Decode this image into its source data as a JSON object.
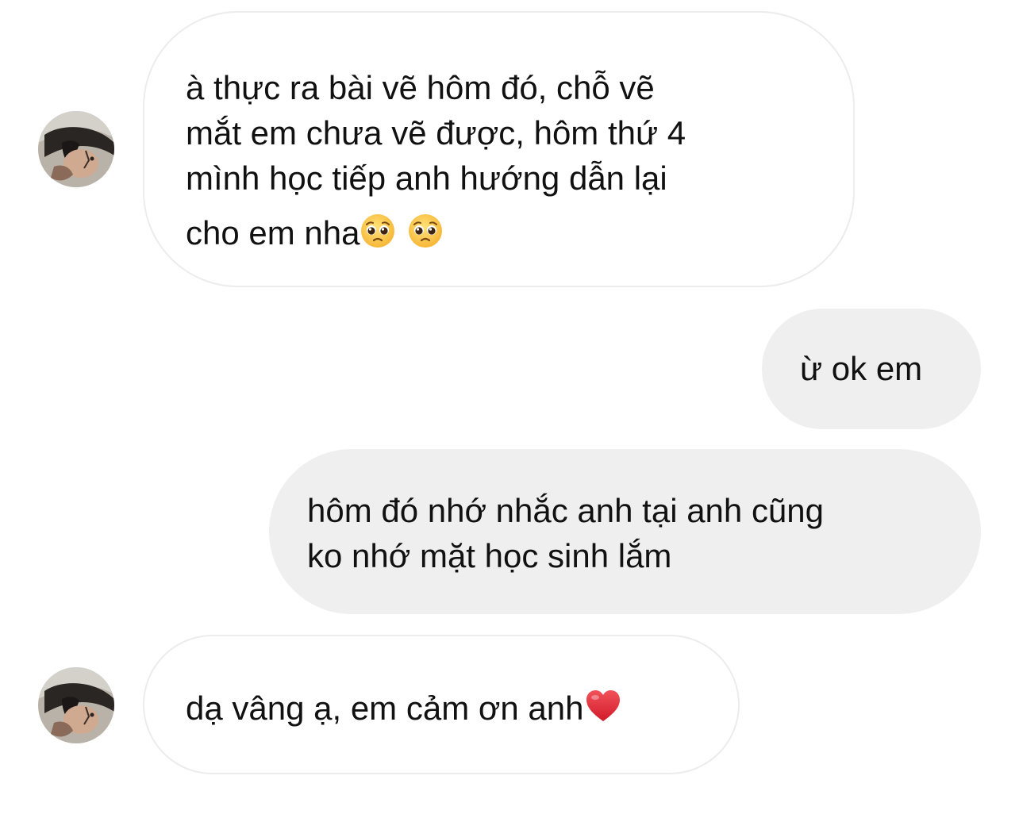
{
  "conversation": {
    "messages": [
      {
        "sender": "other",
        "lines": [
          "à thực ra bài vẽ hôm đó, chỗ vẽ",
          "mắt em chưa vẽ được, hôm thứ 4",
          "mình học tiếp anh hướng dẫn lại",
          "cho em nha"
        ],
        "trailing_emoji": [
          "pleading-face",
          "pleading-face"
        ]
      },
      {
        "sender": "me",
        "lines": [
          "ừ ok em"
        ]
      },
      {
        "sender": "me",
        "lines": [
          "hôm đó nhớ nhắc anh tại anh cũng",
          "ko nhớ mặt học sinh lắm"
        ]
      },
      {
        "sender": "other",
        "lines": [
          "dạ vâng ạ, em cảm ơn anh"
        ],
        "trailing_emoji": [
          "red-heart"
        ]
      }
    ]
  },
  "colors": {
    "incoming_bubble_bg": "#ffffff",
    "incoming_bubble_border": "#ececec",
    "outgoing_bubble_bg": "#efefef",
    "text": "#111111"
  }
}
